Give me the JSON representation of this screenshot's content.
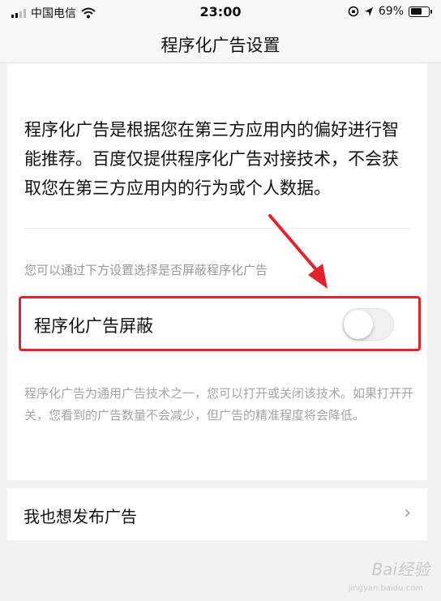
{
  "status_bar": {
    "carrier": "中国电信",
    "time": "23:00",
    "battery_pct": "69%",
    "battery_level": 0.69,
    "icons": [
      "signal-icon",
      "wifi-icon",
      "orientation-lock-icon",
      "location-icon",
      "battery-icon"
    ]
  },
  "nav": {
    "title": "程序化广告设置"
  },
  "main": {
    "intro": "程序化广告是根据您在第三方应用内的偏好进行智能推荐。百度仅提供程序化广告对接技术，不会获取您在第三方应用内的行为或个人数据。",
    "hint": "您可以通过下方设置选择是否屏蔽程序化广告",
    "toggle": {
      "label": "程序化广告屏蔽",
      "state": "off"
    },
    "description": "程序化广告为通用广告技术之一，您可以打开或关闭该技术。如果打开开关，您看到的广告数量不会减少，但广告的精准程度将会降低。"
  },
  "publish": {
    "label": "我也想发布广告",
    "chevron_icon": "chevron-right-icon"
  },
  "watermark": {
    "brand": "Bai经验",
    "sub": "jingyan.baidu.com"
  },
  "colors": {
    "annotation_red": "#e5222b",
    "background": "#f2f2f2",
    "card": "#ffffff"
  }
}
